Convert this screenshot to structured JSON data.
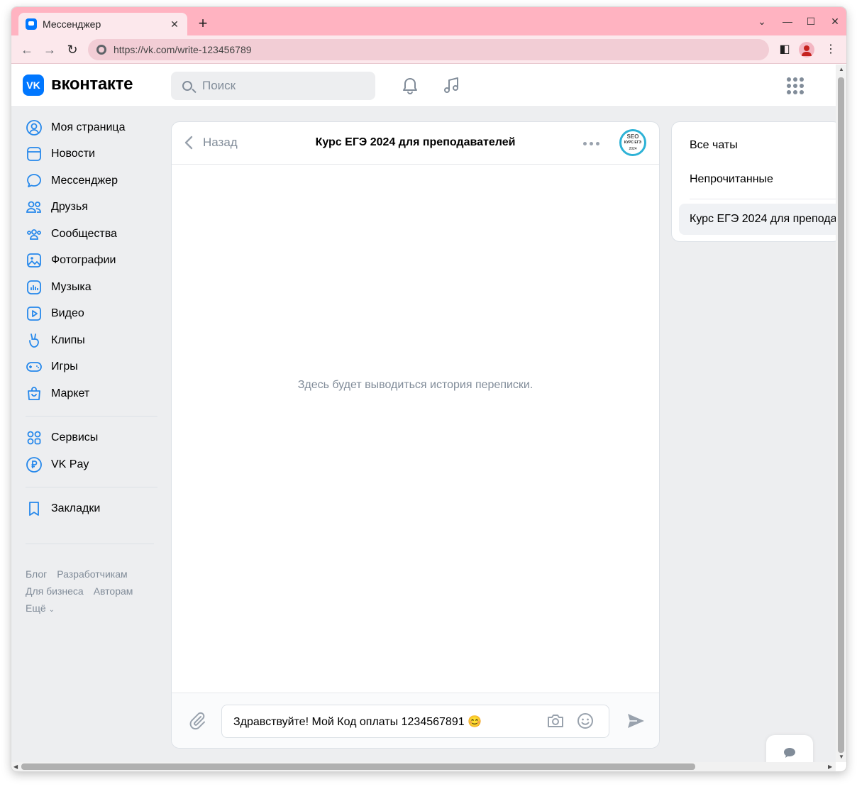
{
  "browser": {
    "tab_title": "Мессенджер",
    "url": "https://vk.com/write-123456789"
  },
  "header": {
    "logo_text": "вконтакте",
    "search_placeholder": "Поиск"
  },
  "sidebar": {
    "items": [
      {
        "label": "Моя страница",
        "icon": "user-circle-icon"
      },
      {
        "label": "Новости",
        "icon": "news-icon"
      },
      {
        "label": "Мессенджер",
        "icon": "message-icon"
      },
      {
        "label": "Друзья",
        "icon": "friends-icon"
      },
      {
        "label": "Сообщества",
        "icon": "communities-icon"
      },
      {
        "label": "Фотографии",
        "icon": "photo-icon"
      },
      {
        "label": "Музыка",
        "icon": "music-icon"
      },
      {
        "label": "Видео",
        "icon": "video-icon"
      },
      {
        "label": "Клипы",
        "icon": "clips-icon"
      },
      {
        "label": "Игры",
        "icon": "gamepad-icon"
      },
      {
        "label": "Маркет",
        "icon": "market-icon"
      }
    ],
    "items2": [
      {
        "label": "Сервисы",
        "icon": "services-icon"
      },
      {
        "label": "VK Pay",
        "icon": "vkpay-icon"
      }
    ],
    "items3": [
      {
        "label": "Закладки",
        "icon": "bookmark-icon"
      }
    ],
    "footer": {
      "blog": "Блог",
      "developers": "Разработчикам",
      "business": "Для бизнеса",
      "authors": "Авторам",
      "more": "Ещё"
    }
  },
  "chat": {
    "back_label": "Назад",
    "title": "Курс ЕГЭ 2024 для преподавателей",
    "avatar": {
      "line1": "SEO",
      "line2": "КУРС ЕГЭ",
      "line3": "2024"
    },
    "empty_text": "Здесь будет выводиться история переписки.",
    "input_value": "Здравствуйте! Мой Код оплаты 1234567891 😊"
  },
  "right_panel": {
    "all_chats": "Все чаты",
    "unread": "Непрочитанные",
    "active_chat": "Курс ЕГЭ 2024 для препода"
  },
  "colors": {
    "accent": "#0077ff",
    "titlebar": "#ffb3c1",
    "page_bg": "#edeef0"
  }
}
